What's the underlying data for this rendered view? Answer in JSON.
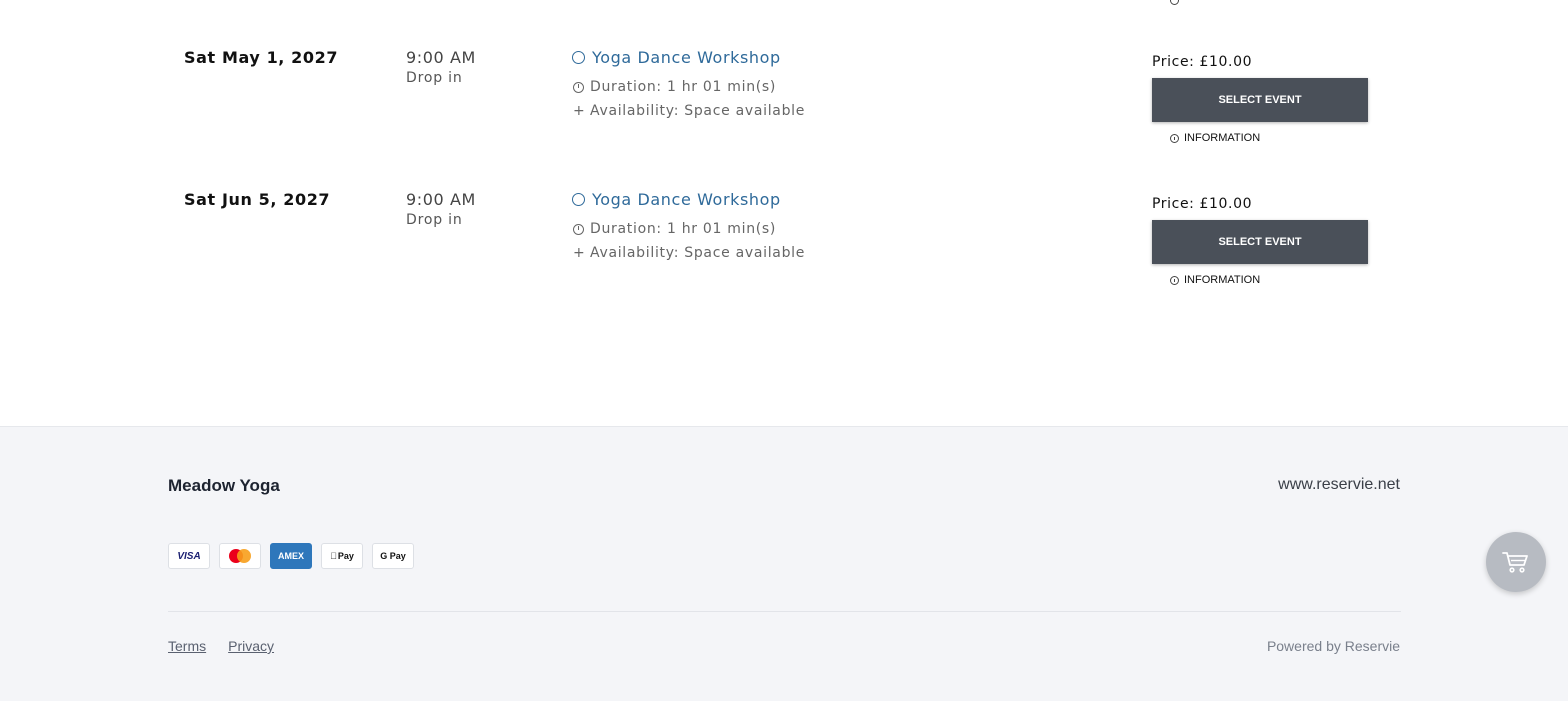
{
  "events": [
    {
      "date": "Sat May 1, 2027",
      "time": "9:00 AM",
      "type": "Drop in",
      "title": "Yoga Dance Workshop",
      "duration": "Duration: 1 hr 01 min(s)",
      "availability": "Availability: Space available",
      "price": "Price: £10.00",
      "select_label": "SELECT EVENT",
      "info_label": "INFORMATION"
    },
    {
      "date": "Sat Jun 5, 2027",
      "time": "9:00 AM",
      "type": "Drop in",
      "title": "Yoga Dance Workshop",
      "duration": "Duration: 1 hr 01 min(s)",
      "availability": "Availability: Space available",
      "price": "Price: £10.00",
      "select_label": "SELECT EVENT",
      "info_label": "INFORMATION"
    }
  ],
  "footer": {
    "brand": "Meadow Yoga",
    "site": "www.reservie.net",
    "payments": [
      "VISA",
      "mastercard",
      "AMEX",
      "Pay",
      "G Pay"
    ],
    "links": [
      "Terms",
      "Privacy"
    ],
    "powered": "Powered by Reservie"
  },
  "icons": {
    "title": "circle-icon",
    "duration": "clock-icon",
    "availability": "plus-icon",
    "info": "info-icon",
    "cart": "cart-icon"
  },
  "colors": {
    "accent_link": "#2f6a9a",
    "button_bg": "#4a5059",
    "footer_bg": "#f4f5f8",
    "amex": "#2e77bb"
  }
}
